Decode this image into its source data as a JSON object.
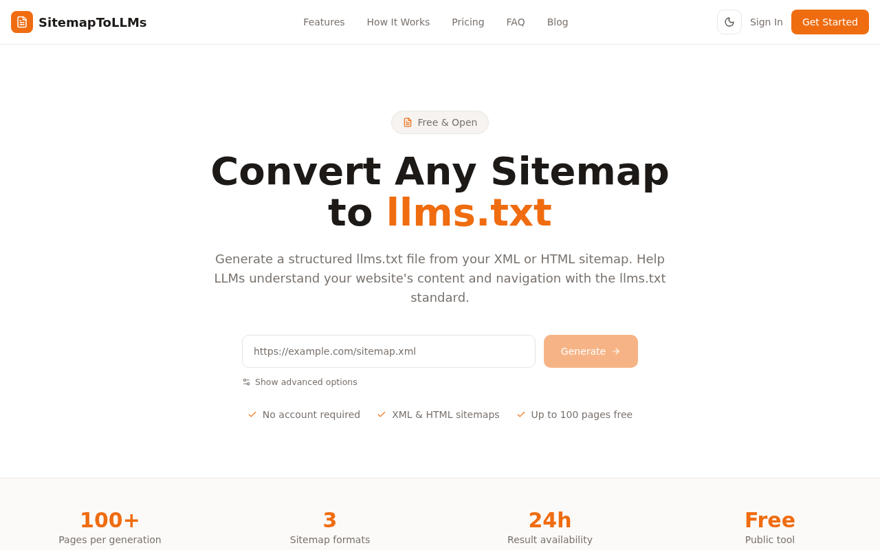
{
  "header": {
    "brand": "SitemapToLLMs",
    "nav": [
      "Features",
      "How It Works",
      "Pricing",
      "FAQ",
      "Blog"
    ],
    "sign_in": "Sign In",
    "cta": "Get Started"
  },
  "hero": {
    "badge": "Free & Open",
    "title": "Convert Any Sitemap to",
    "title_highlight": "llms.txt",
    "subtitle": "Generate a structured llms.txt file from your XML or HTML sitemap. Help LLMs understand your website's content and navigation with the llms.txt standard.",
    "form": {
      "placeholder": "https://example.com/sitemap.xml",
      "button": "Generate",
      "disabled": true
    },
    "advanced_options": "Show advanced options",
    "features": [
      "No account required",
      "XML & HTML sitemaps",
      "Up to 100 pages free"
    ]
  },
  "stats": [
    {
      "value": "100+",
      "label": "Pages per generation"
    },
    {
      "value": "3",
      "label": "Sitemap formats"
    },
    {
      "value": "24h",
      "label": "Result availability"
    },
    {
      "value": "Free",
      "label": "Public tool"
    }
  ]
}
